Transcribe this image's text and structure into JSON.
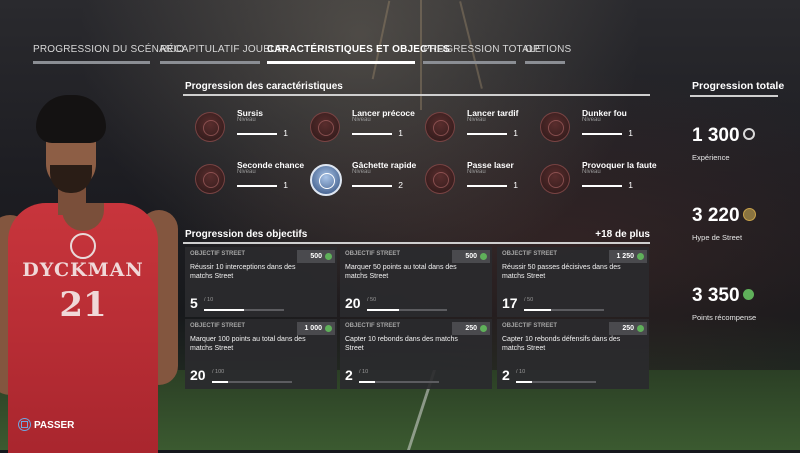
{
  "tabs": [
    {
      "label": "PROGRESSION DU SCÉNARIO",
      "active": false
    },
    {
      "label": "RÉCAPITULATIF JOUEUR",
      "active": false
    },
    {
      "label": "CARACTÉRISTIQUES ET OBJECTIFS",
      "active": true
    },
    {
      "label": "PROGRESSION TOTALE",
      "active": false
    },
    {
      "label": "OPTIONS",
      "active": false
    }
  ],
  "player": {
    "team": "DYCKMAN",
    "number": "21"
  },
  "attributes": {
    "title": "Progression des caractéristiques",
    "level_label": "Niveau",
    "items": [
      {
        "name": "Sursis",
        "level": "1",
        "badge": "locked"
      },
      {
        "name": "Lancer précoce",
        "level": "1",
        "badge": "locked"
      },
      {
        "name": "Lancer tardif",
        "level": "1",
        "badge": "locked"
      },
      {
        "name": "Dunker fou",
        "level": "1",
        "badge": "locked"
      },
      {
        "name": "Seconde chance",
        "level": "1",
        "badge": "locked"
      },
      {
        "name": "Gâchette rapide",
        "level": "2",
        "badge": "active"
      },
      {
        "name": "Passe laser",
        "level": "1",
        "badge": "locked"
      },
      {
        "name": "Provoquer la faute",
        "level": "1",
        "badge": "locked"
      }
    ]
  },
  "objectives": {
    "title": "Progression des objectifs",
    "more": "+18 de plus",
    "cards": [
      {
        "tag": "OBJECTIF STREET",
        "desc": "Réussir 10 interceptions dans des matchs Street",
        "points": "500",
        "current": "5",
        "max": "/ 10",
        "progress": 0.5
      },
      {
        "tag": "OBJECTIF STREET",
        "desc": "Marquer 50 points au total dans des matchs Street",
        "points": "500",
        "current": "20",
        "max": "/ 50",
        "progress": 0.4
      },
      {
        "tag": "OBJECTIF STREET",
        "desc": "Réussir 50 passes décisives dans des matchs Street",
        "points": "1 250",
        "current": "17",
        "max": "/ 50",
        "progress": 0.34
      },
      {
        "tag": "OBJECTIF STREET",
        "desc": "Marquer 100 points au total dans des matchs Street",
        "points": "1 000",
        "current": "20",
        "max": "/ 100",
        "progress": 0.2
      },
      {
        "tag": "OBJECTIF STREET",
        "desc": "Capter 10 rebonds dans des matchs Street",
        "points": "250",
        "current": "2",
        "max": "/ 10",
        "progress": 0.2
      },
      {
        "tag": "OBJECTIF STREET",
        "desc": "Capter 10 rebonds défensifs dans des matchs Street",
        "points": "250",
        "current": "2",
        "max": "/ 10",
        "progress": 0.2
      }
    ]
  },
  "totals": {
    "title": "Progression totale",
    "stats": [
      {
        "value": "1 300",
        "label": "Expérience",
        "icon": "xp-icon",
        "color": "#d9d9d9"
      },
      {
        "value": "3 220",
        "label": "Hype de Street",
        "icon": "hype-icon",
        "color": "#c9a24a"
      },
      {
        "value": "3 350",
        "label": "Points récompense",
        "icon": "rewards-icon",
        "color": "#5fb05a"
      }
    ]
  },
  "footer": {
    "skip_label": "PASSER",
    "skip_button_icon": "square-button-icon"
  }
}
